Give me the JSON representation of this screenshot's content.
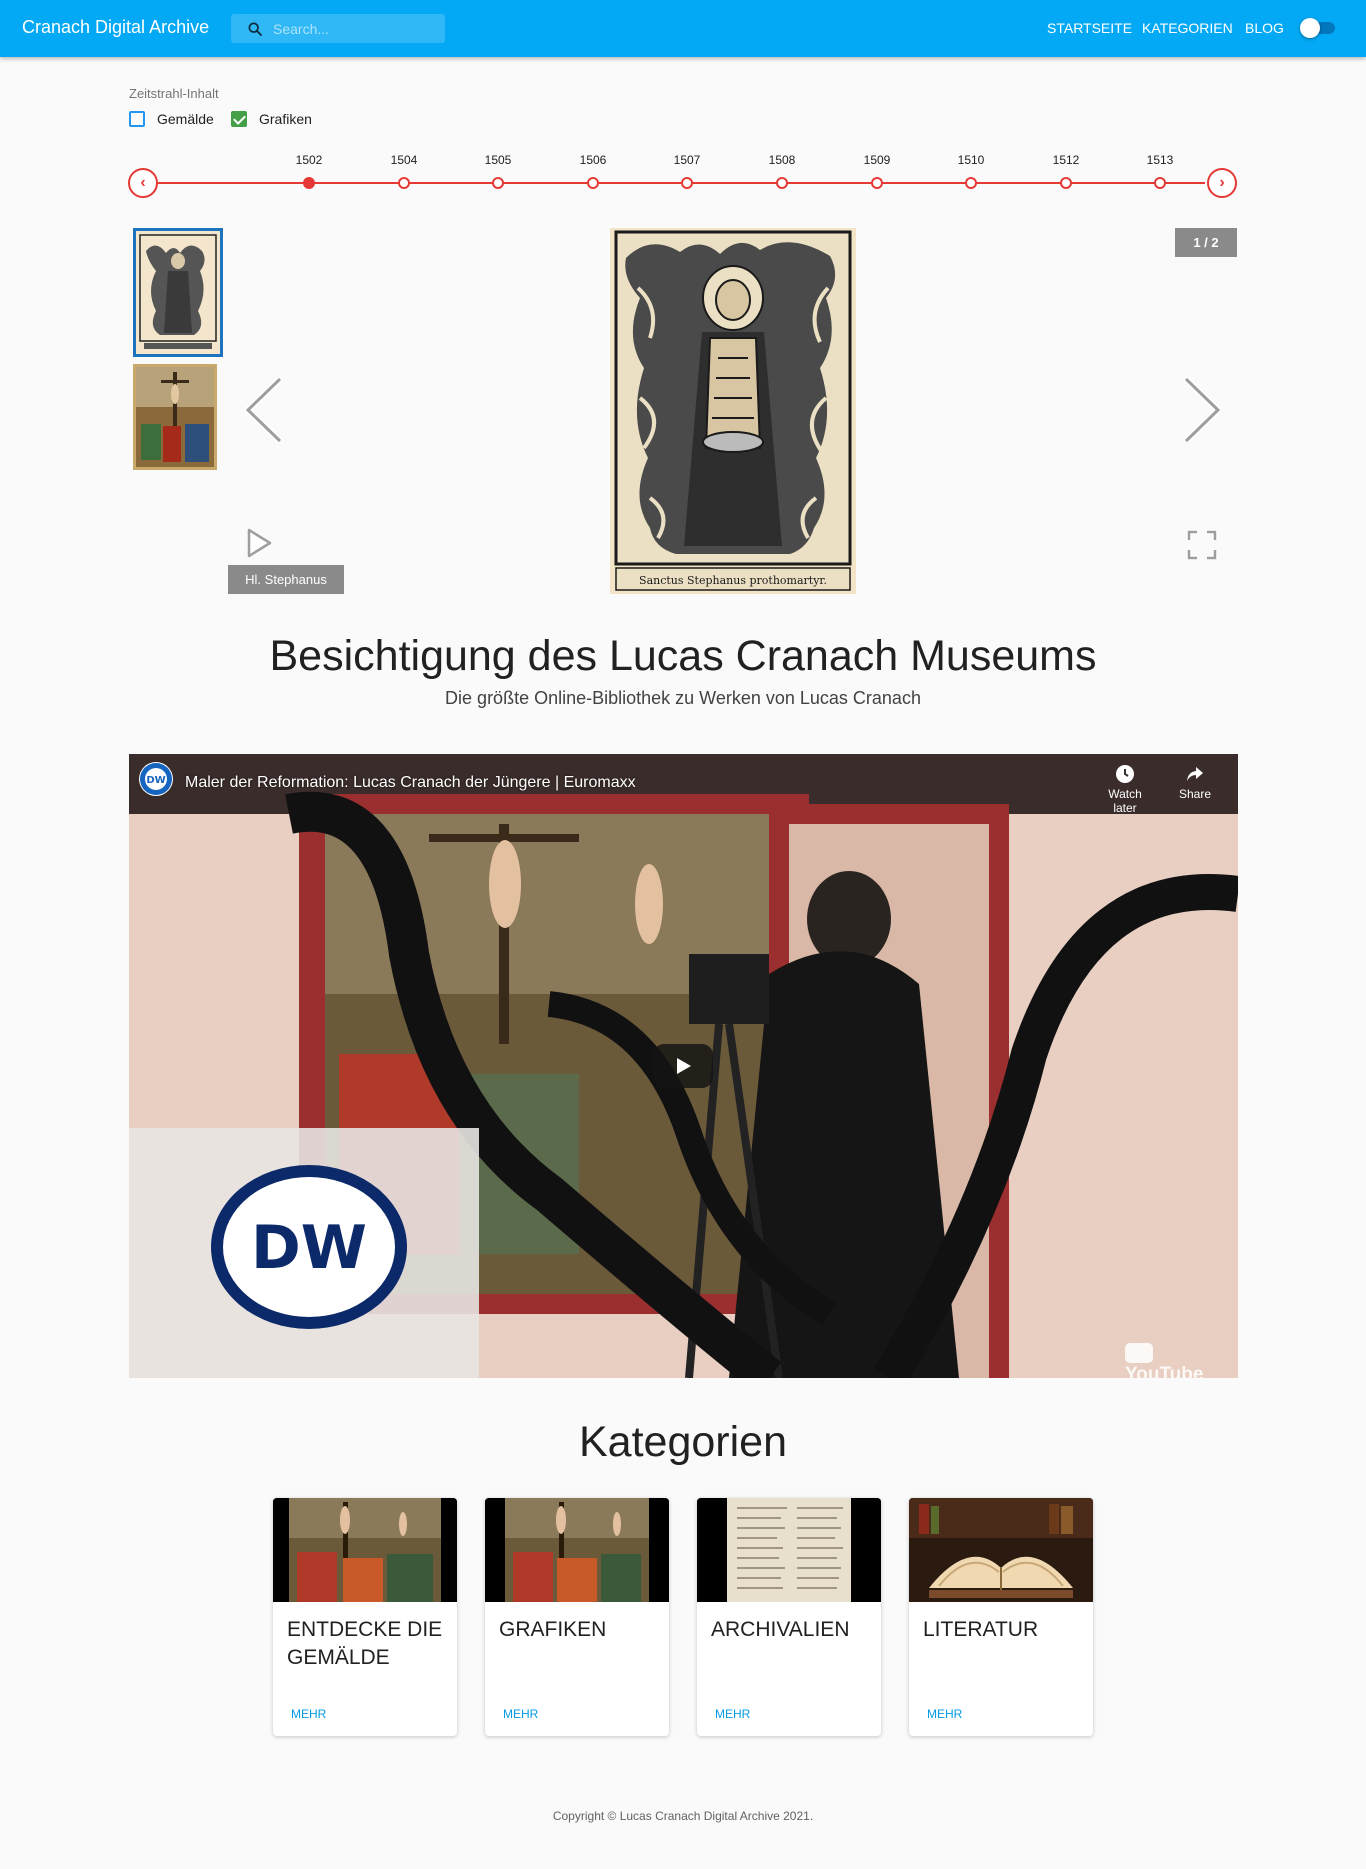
{
  "header": {
    "brand": "Cranach Digital Archive",
    "search_placeholder": "Search...",
    "nav": [
      "STARTSEITE",
      "KATEGORIEN",
      "BLOG"
    ],
    "theme_toggle_on": true
  },
  "timeline": {
    "label": "Zeitstrahl-Inhalt",
    "filters": [
      {
        "label": "Gemälde",
        "checked": false
      },
      {
        "label": "Grafiken",
        "checked": true
      }
    ],
    "years": [
      "1502",
      "1504",
      "1505",
      "1506",
      "1507",
      "1508",
      "1509",
      "1510",
      "1512",
      "1513"
    ],
    "active_year": "1502",
    "prev_icon": "chevron-left-icon",
    "next_icon": "chevron-right-icon"
  },
  "gallery": {
    "counter": "1 / 2",
    "caption": "Hl. Stephanus",
    "inscription": "Sanctus Stephanus prothomartyr."
  },
  "hero": {
    "title": "Besichtigung des Lucas Cranach Museums",
    "subtitle": "Die größte Online-Bibliothek zu Werken von Lucas Cranach"
  },
  "video": {
    "title": "Maler der Reformation: Lucas Cranach der Jüngere | Euromaxx",
    "channel_logo": "DW",
    "watch_later": "Watch later",
    "share": "Share",
    "platform": "YouTube"
  },
  "categories": {
    "title": "Kategorien",
    "items": [
      {
        "name": "ENTDECKE DIE GEMÄLDE",
        "more": "MEHR"
      },
      {
        "name": "GRAFIKEN",
        "more": "MEHR"
      },
      {
        "name": "ARCHIVALIEN",
        "more": "MEHR"
      },
      {
        "name": "LITERATUR",
        "more": "MEHR"
      }
    ]
  },
  "footer": {
    "copyright": "Copyright © Lucas Cranach Digital Archive 2021."
  },
  "colors": {
    "appbar": "#03a9f4",
    "timeline": "#e53935",
    "link": "#039be5",
    "selected_thumb_border": "#1e73be"
  }
}
